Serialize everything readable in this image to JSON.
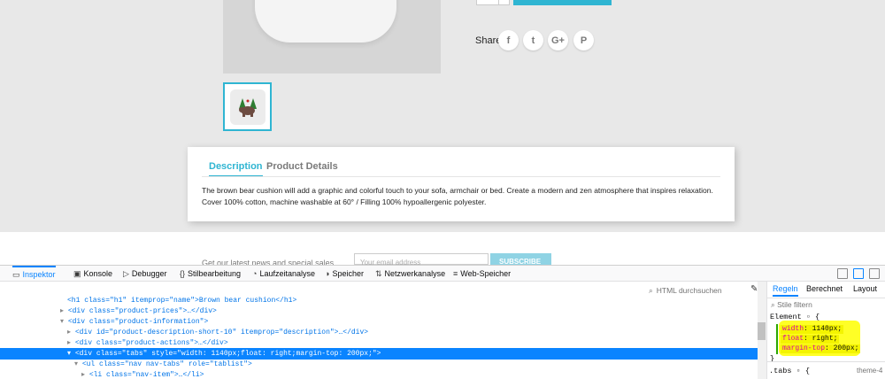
{
  "share": {
    "label": "Share",
    "buttons": [
      "f",
      "t",
      "G+",
      "P"
    ]
  },
  "tabs": {
    "description_label": "Description",
    "details_label": "Product Details",
    "description_text": "The brown bear cushion will add a graphic and colorful touch to your sofa, armchair or bed. Create a modern and zen atmosphere that inspires relaxation. Cover 100% cotton, machine washable at 60° / Filling 100% hypoallergenic polyester."
  },
  "footer": {
    "newsletter_text": "Get our latest news and special sales",
    "email_placeholder": "Your email address",
    "subscribe_label": "SUBSCRIBE"
  },
  "devtools": {
    "tabs": [
      "Inspektor",
      "Konsole",
      "Debugger",
      "Stilbearbeitung",
      "Laufzeitanalyse",
      "Speicher",
      "Netzwerkanalyse",
      "Web-Speicher"
    ],
    "search_placeholder": "HTML durchsuchen",
    "rules_tabs": [
      "Regeln",
      "Berechnet",
      "Layout"
    ],
    "rules_filter_placeholder": "Stile filtern",
    "element_rule": "Element",
    "declarations": [
      {
        "prop": "width",
        "value": "1140px;"
      },
      {
        "prop": "float",
        "value": "right;"
      },
      {
        "prop": "margin-top",
        "value": "200px;"
      }
    ],
    "next_rule_selector": ".tabs",
    "next_rule_source": "theme-4"
  },
  "html_lines": [
    "<h1 class=\"h1\" itemprop=\"name\">Brown bear cushion</h1>",
    "<div class=\"product-prices\">…</div>",
    "<div class=\"product-information\">",
    "<div id=\"product-description-short-10\" itemprop=\"description\">…</div>",
    "<div class=\"product-actions\">…</div>",
    "<div class=\"tabs\" style=\"width: 1140px;float: right;margin-top: 200px;\">",
    "<ul class=\"nav nav-tabs\" role=\"tablist\">",
    "<li class=\"nav-item\">…</li>"
  ],
  "colors": {
    "accent": "#2fb5d2",
    "devtools_selection": "#0a84ff",
    "highlight": "#ffff00"
  }
}
